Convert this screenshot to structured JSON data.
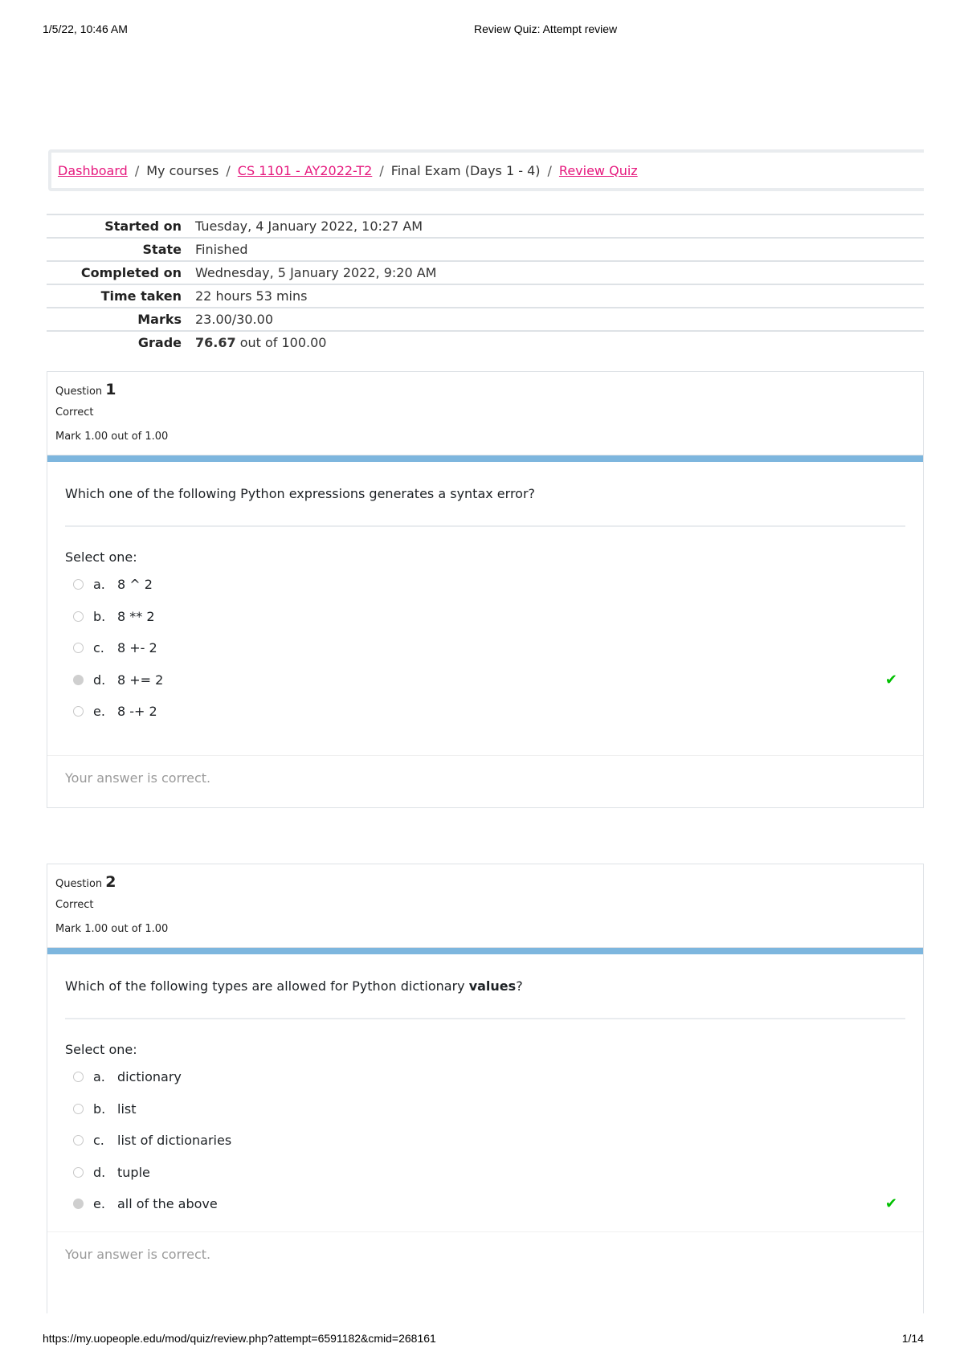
{
  "print_header": {
    "date": "1/5/22, 10:46 AM",
    "title": "Review Quiz: Attempt review"
  },
  "breadcrumb": {
    "items": [
      {
        "label": "Dashboard",
        "link": true
      },
      {
        "label": "My courses",
        "link": false
      },
      {
        "label": "CS 1101 - AY2022-T2",
        "link": true
      },
      {
        "label": "Final Exam (Days 1 - 4)",
        "link": false
      },
      {
        "label": "Review Quiz",
        "link": true
      }
    ],
    "separator": "/"
  },
  "summary": {
    "rows": [
      {
        "label": "Started on",
        "value": "Tuesday, 4 January 2022, 10:27 AM"
      },
      {
        "label": "State",
        "value": "Finished"
      },
      {
        "label": "Completed on",
        "value": "Wednesday, 5 January 2022, 9:20 AM"
      },
      {
        "label": "Time taken",
        "value": "22 hours 53 mins"
      },
      {
        "label": "Marks",
        "value": "23.00/30.00"
      }
    ],
    "grade": {
      "label": "Grade",
      "value_bold": "76.67",
      "value_rest": " out of 100.00"
    }
  },
  "questions": [
    {
      "prefix": "Question",
      "number": "1",
      "state": "Correct",
      "mark": "Mark 1.00 out of 1.00",
      "text": "Which one of the following Python expressions generates a syntax error?",
      "select_label": "Select one:",
      "answers": [
        {
          "letter": "a.",
          "text": "8 ^ 2",
          "selected": false
        },
        {
          "letter": "b.",
          "text": "8 ** 2",
          "selected": false
        },
        {
          "letter": "c.",
          "text": "8 +- 2",
          "selected": false
        },
        {
          "letter": "d.",
          "text": "8 += 2",
          "selected": true
        },
        {
          "letter": "e.",
          "text": "8 -+ 2",
          "selected": false
        }
      ],
      "feedback": "Your answer is correct."
    },
    {
      "prefix": "Question",
      "number": "2",
      "state": "Correct",
      "mark": "Mark 1.00 out of 1.00",
      "text_before": "Which of the following types are allowed for Python dictionary ",
      "text_bold": "values",
      "text_after": "?",
      "select_label": "Select one:",
      "answers": [
        {
          "letter": "a.",
          "text": "dictionary",
          "selected": false
        },
        {
          "letter": "b.",
          "text": "list",
          "selected": false
        },
        {
          "letter": "c.",
          "text": "list of dictionaries",
          "selected": false
        },
        {
          "letter": "d.",
          "text": "tuple",
          "selected": false
        },
        {
          "letter": "e.",
          "text": "all of the above",
          "selected": true
        }
      ],
      "feedback": "Your answer is correct."
    }
  ],
  "icons": {
    "correct": "✔"
  },
  "colors": {
    "link": "#e6197e",
    "question_bar": "#7db6de",
    "correct_check": "#00c000"
  },
  "print_footer": {
    "url": "https://my.uopeople.edu/mod/quiz/review.php?attempt=6591182&cmid=268161",
    "page": "1/14"
  }
}
